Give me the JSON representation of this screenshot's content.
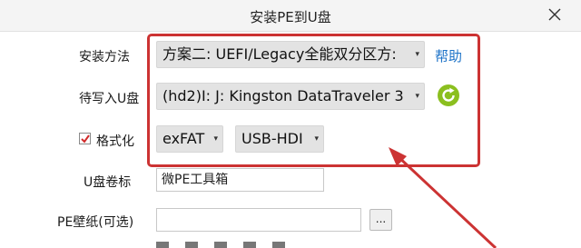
{
  "window": {
    "title": "安装PE到U盘",
    "close_icon": "close-icon"
  },
  "colors": {
    "highlight": "#cc3333",
    "link": "#1e73c8",
    "refresh_icon": "#8bbf1f"
  },
  "form": {
    "install_method": {
      "label": "安装方法",
      "value": "方案二:  UEFI/Legacy全能双分区方:",
      "help_link": "帮助"
    },
    "target_drive": {
      "label": "待写入U盘",
      "value": "(hd2)I: J: Kingston DataTraveler 3",
      "refresh_icon": "refresh-icon"
    },
    "format": {
      "label": "格式化",
      "checked": true,
      "filesystem": "exFAT",
      "mode": "USB-HDI"
    },
    "volume_label": {
      "label": "U盘卷标",
      "value": "微PE工具箱"
    },
    "wallpaper": {
      "label": "PE壁纸(可选)",
      "value": "",
      "browse_label": "..."
    }
  }
}
